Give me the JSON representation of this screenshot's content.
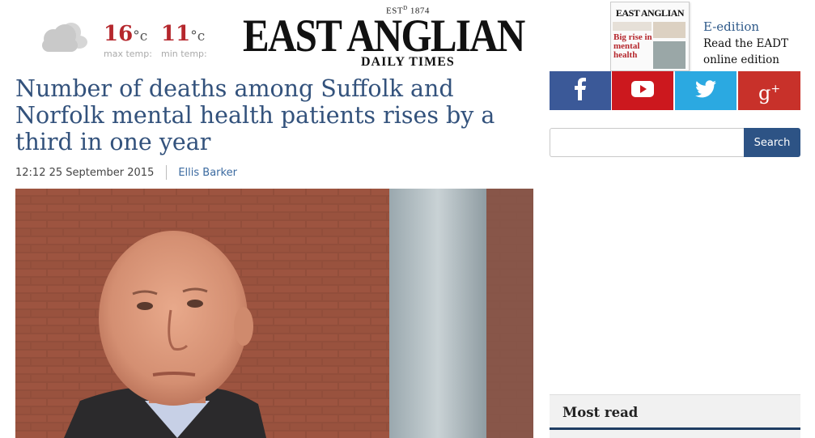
{
  "weather": {
    "icon": "cloud-icon",
    "max_value": "16",
    "max_unit": "°c",
    "max_label": "max temp:",
    "min_value": "11",
    "min_unit": "°c",
    "min_label": "min temp:"
  },
  "masthead": {
    "est_prefix": "EST",
    "est_sup": "D",
    "est_year": "1874",
    "title": "EAST ANGLIAN",
    "subtitle": "DAILY TIMES"
  },
  "eedition": {
    "thumb_title": "EAST ANGLIAN",
    "thumb_headline": "Big rise in mental health",
    "title": "E-edition",
    "text": "Read the EADT online edition"
  },
  "article": {
    "headline": "Number of deaths among Suffolk and Norfolk mental health patients rises by a third in one year",
    "time": "12:12 25 September 2015",
    "author": "Ellis Barker"
  },
  "social": {
    "facebook_icon": "facebook-icon",
    "youtube_icon": "youtube-icon",
    "twitter_icon": "twitter-icon",
    "googleplus_icon": "google-plus-icon",
    "colors": {
      "facebook": "#3b5998",
      "youtube": "#cc181e",
      "twitter": "#2ba9e1",
      "googleplus": "#c8312a"
    }
  },
  "search": {
    "placeholder": "",
    "button_label": "Search"
  },
  "sidebar": {
    "most_read_title": "Most read"
  },
  "colors": {
    "headline": "#33527c",
    "accent": "#2d5385",
    "temperature": "#b5272d"
  }
}
